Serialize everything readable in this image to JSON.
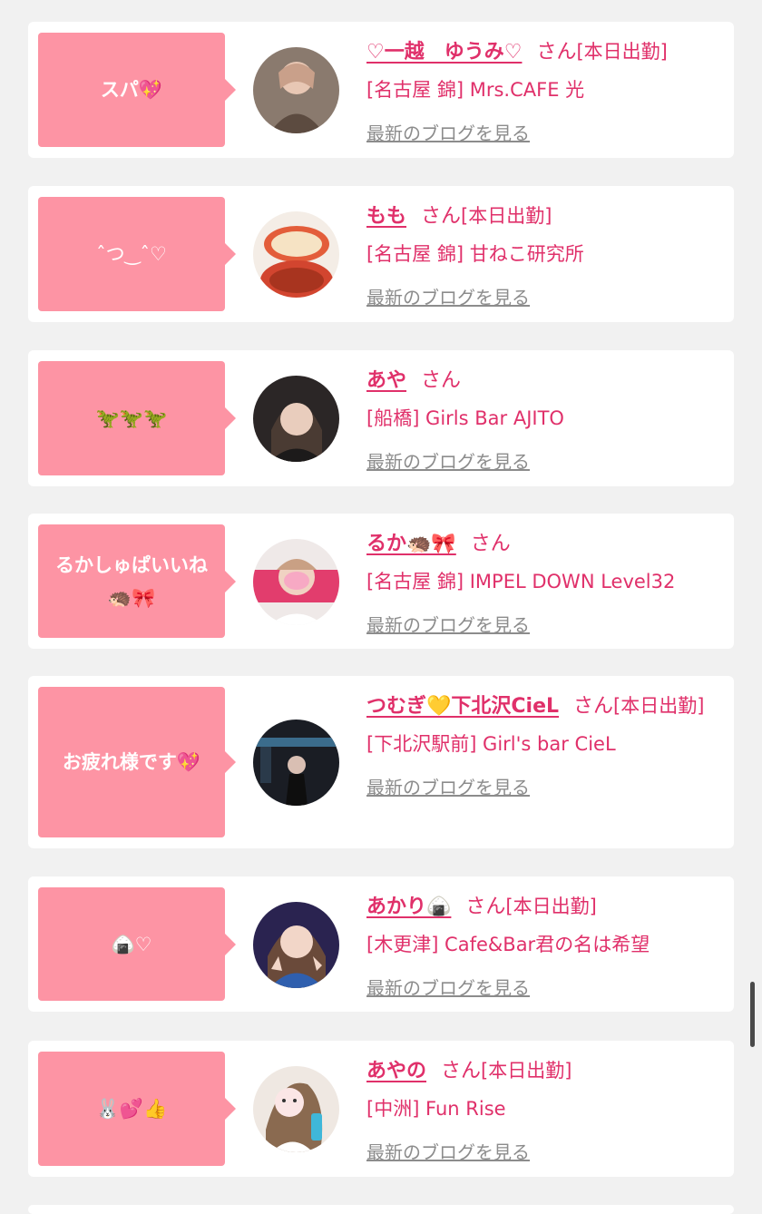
{
  "blog_link_label": "最新のブログを見る",
  "san_label": "さん",
  "colors": {
    "bubble": "#fd94a4",
    "name": "#e0306a",
    "link": "#8c8c8c",
    "background": "#f1f1f1"
  },
  "cards": [
    {
      "message": "スパ💖",
      "name": "♡一越　ゆうみ♡",
      "badge": "[本日出勤]",
      "shop": "[名古屋 錦] Mrs.CAFE 光",
      "avatar": "avatar-photo-1"
    },
    {
      "message": "ˆつ‿ˆ♡",
      "name": "もも",
      "badge": "[本日出勤]",
      "shop": "[名古屋 錦] 甘ねこ研究所",
      "avatar": "avatar-photo-2"
    },
    {
      "message": "🦖🦖🦖",
      "name": "あや",
      "badge": "",
      "shop": "[船橋] Girls Bar AJITO",
      "avatar": "avatar-photo-3"
    },
    {
      "message": "るかしゅぱいいね🦔🎀",
      "name": "るか🦔🎀",
      "badge": "",
      "shop": "[名古屋 錦] IMPEL DOWN Level32",
      "avatar": "avatar-photo-4"
    },
    {
      "message": "お疲れ様です💖",
      "name": "つむぎ💛下北沢CieL",
      "badge": "[本日出勤]",
      "shop": "[下北沢駅前] Girl's bar CieL",
      "avatar": "avatar-photo-5"
    },
    {
      "message": "🍙♡",
      "name": "あかり🍙",
      "badge": "[本日出勤]",
      "shop": "[木更津] Cafe&Bar君の名は希望",
      "avatar": "avatar-photo-6"
    },
    {
      "message": "🐰💕👍",
      "name": "あやの",
      "badge": "[本日出勤]",
      "shop": "[中洲] Fun Rise",
      "avatar": "avatar-photo-7"
    }
  ]
}
